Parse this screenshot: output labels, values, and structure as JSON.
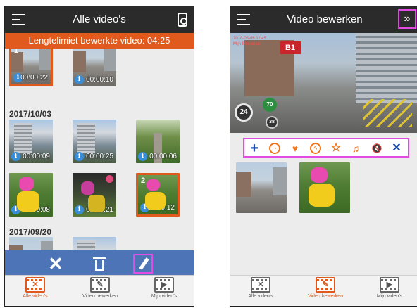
{
  "left": {
    "title": "Alle video's",
    "banner": "Lengtelimiet bewerkte video: 04:25",
    "top_row": [
      {
        "duration": "00:00:22",
        "selected_num": "1",
        "scene": "street",
        "selected": true
      },
      {
        "duration": "00:00:10",
        "selected_num": "",
        "scene": "street",
        "selected": false
      }
    ],
    "group1": {
      "date": "2017/10/03",
      "row1": [
        {
          "duration": "00:00:09",
          "scene": "tower"
        },
        {
          "duration": "00:00:25",
          "scene": "tower"
        },
        {
          "duration": "00:00:06",
          "scene": "path"
        }
      ],
      "row2": [
        {
          "duration": "00:00:08",
          "scene": "bike"
        },
        {
          "duration": "00:00:21",
          "scene": "bikedark"
        },
        {
          "duration": "00:00:12",
          "scene": "bike",
          "selected_num": "2",
          "selected": true
        }
      ]
    },
    "group2": {
      "date": "2017/09/20"
    }
  },
  "right": {
    "title": "Video bewerken",
    "overlay_date": "2018-03-06 11:45",
    "overlay_sub": "Mijn fietsvideo",
    "gauge_speed": "24",
    "gauge_hr": "70",
    "gauge_cadence": "38",
    "expand_glyph": "»"
  },
  "nav": {
    "items": [
      {
        "label": "Alle video's",
        "glyph": "✕"
      },
      {
        "label": "Video bewerken",
        "glyph": "✎"
      },
      {
        "label": "Mijn video's",
        "glyph": "▶"
      }
    ]
  },
  "toolbar": {
    "close_glyph": "✕",
    "edit_glyph": "✎"
  },
  "edit_tools": [
    {
      "name": "add",
      "glyph": "+"
    },
    {
      "name": "speed",
      "glyph": "◔"
    },
    {
      "name": "heartrate",
      "glyph": "♥"
    },
    {
      "name": "power",
      "glyph": "ϟ"
    },
    {
      "name": "favorite",
      "glyph": "☆"
    },
    {
      "name": "music",
      "glyph": "♫"
    },
    {
      "name": "mute",
      "glyph": "🔇"
    },
    {
      "name": "close",
      "glyph": "✕"
    }
  ],
  "colors": {
    "accent_orange": "#e05a1e",
    "toolbar_blue": "#4e74b8",
    "highlight_magenta": "#e24be4",
    "icon_blue": "#1c4fb3"
  }
}
